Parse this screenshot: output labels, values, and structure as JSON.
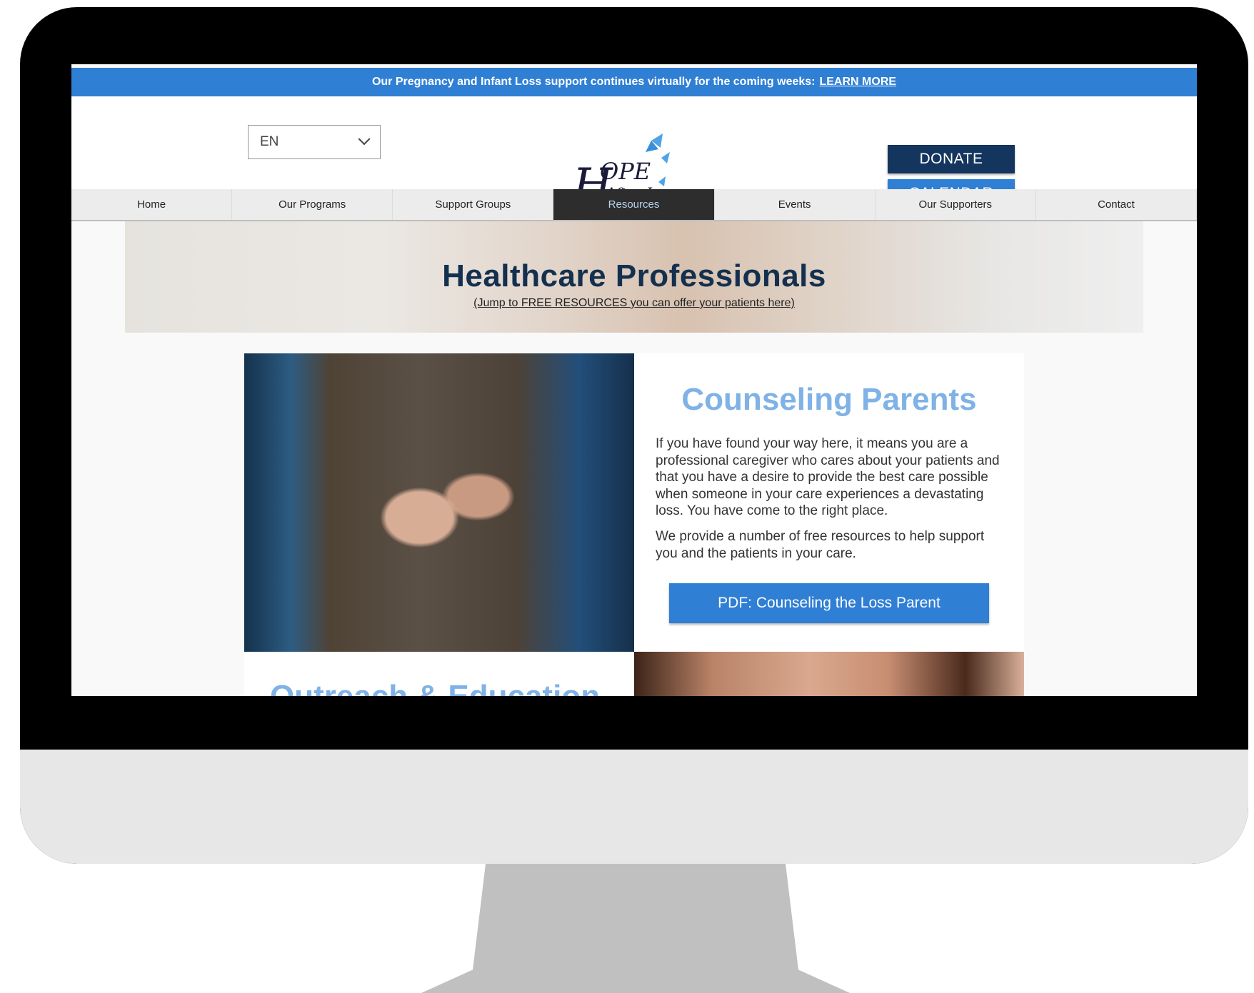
{
  "announcement": {
    "text": "Our Pregnancy and Infant Loss support continues virtually for the coming weeks:",
    "link": "LEARN MORE"
  },
  "header": {
    "language": "EN",
    "logo_line1": "HOPE",
    "logo_line2": "After Loss",
    "donate": "DONATE",
    "calendar": "CALENDAR"
  },
  "nav": {
    "items": [
      "Home",
      "Our Programs",
      "Support Groups",
      "Resources",
      "Events",
      "Our Supporters",
      "Contact"
    ],
    "active": "Resources"
  },
  "hero": {
    "title": "Healthcare Professionals",
    "subtitle": "(Jump to FREE RESOURCES you can offer your patients here)"
  },
  "card": {
    "title": "Counseling Parents",
    "paragraph1": "If you have found your way here, it means you are a professional caregiver who cares about your patients and that you have a desire to provide the best care possible when someone in your care experiences a devastating loss. You have come to the right place.",
    "paragraph2": "We provide a number of free resources to help support you and the patients in your care.",
    "button": "PDF: Counseling the Loss Parent"
  },
  "next_section": {
    "title": "Outreach & Education"
  },
  "colors": {
    "brand_blue": "#2f7fd4",
    "navy": "#13355e",
    "light_blue_heading": "#7fb2e6",
    "nav_active_bg": "#2d2d2d"
  }
}
